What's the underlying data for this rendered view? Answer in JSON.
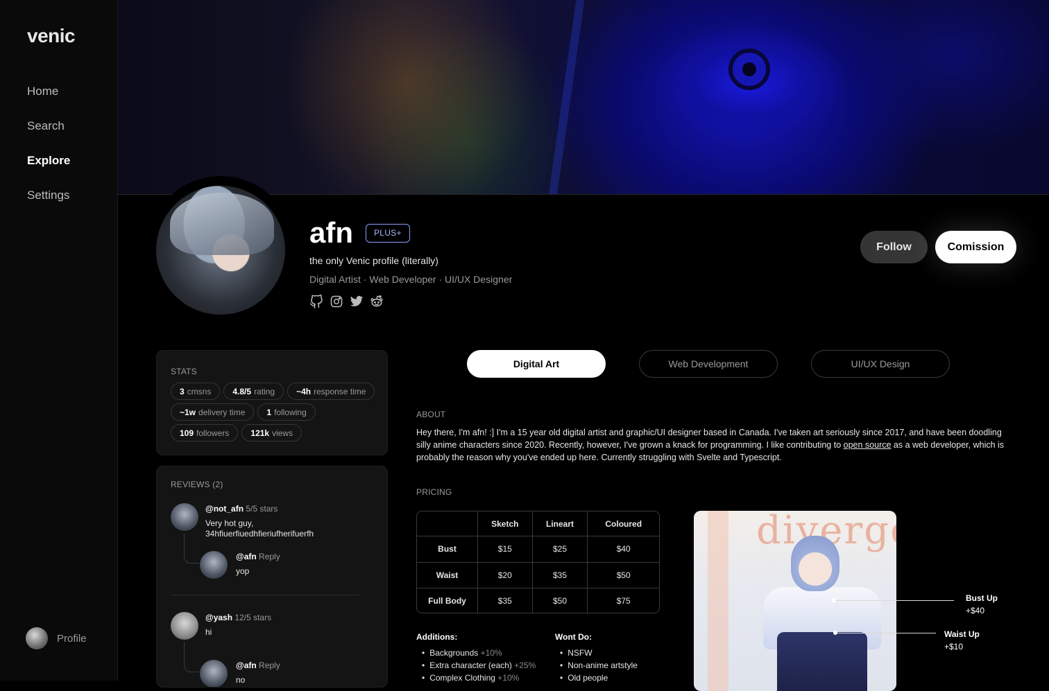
{
  "sidebar": {
    "logo": "venic",
    "nav": [
      {
        "label": "Home",
        "active": false
      },
      {
        "label": "Search",
        "active": false
      },
      {
        "label": "Explore",
        "active": true
      },
      {
        "label": "Settings",
        "active": false
      }
    ],
    "profile_label": "Profile"
  },
  "profile": {
    "username": "afn",
    "badge": "PLUS+",
    "tagline": "the only Venic profile (literally)",
    "roles": "Digital Artist · Web Developer · UI/UX Designer",
    "socials": [
      "github-icon",
      "instagram-icon",
      "twitter-icon",
      "reddit-icon"
    ],
    "follow_label": "Follow",
    "commission_label": "Comission"
  },
  "stats": {
    "title": "STATS",
    "chips": [
      {
        "value": "3",
        "label": "cmsns"
      },
      {
        "value": "4.8/5",
        "label": "rating"
      },
      {
        "value": "~4h",
        "label": "response time"
      },
      {
        "value": "~1w",
        "label": "delivery time"
      },
      {
        "value": "1",
        "label": "following"
      },
      {
        "value": "109",
        "label": "followers"
      },
      {
        "value": "121k",
        "label": "views"
      }
    ]
  },
  "reviews": {
    "title": "REVIEWS (2)",
    "items": [
      {
        "user": "@not_afn",
        "meta": "5/5 stars",
        "text": "Very hot guy, 34hfiuerfiuedhfieriufherifuerfh",
        "reply": {
          "user": "@afn",
          "meta": "Reply",
          "text": "yop"
        }
      },
      {
        "user": "@yash",
        "meta": "12/5 stars",
        "text": "hi",
        "reply": {
          "user": "@afn",
          "meta": "Reply",
          "text": "no"
        }
      }
    ]
  },
  "tabs": [
    {
      "label": "Digital Art",
      "active": true
    },
    {
      "label": "Web Development",
      "active": false
    },
    {
      "label": "UI/UX Design",
      "active": false
    }
  ],
  "about": {
    "title": "ABOUT",
    "text_before": "Hey there, I'm afn! :] I'm a 15 year old digital artist and graphic/UI designer based in Canada. I've taken art seriously since 2017, and have been doodling silly anime characters since 2020. Recently, however, I've grown a knack for programming. I like contributing to ",
    "link": "open source",
    "text_after": " as a web developer, which is probably the reason why you've ended up here. Currently struggling with Svelte and Typescript."
  },
  "pricing": {
    "title": "PRICING",
    "columns": [
      "Sketch",
      "Lineart",
      "Coloured"
    ],
    "rows": [
      {
        "label": "Bust",
        "values": [
          "$15",
          "$25",
          "$40"
        ]
      },
      {
        "label": "Waist",
        "values": [
          "$20",
          "$35",
          "$50"
        ]
      },
      {
        "label": "Full Body",
        "values": [
          "$35",
          "$50",
          "$75"
        ]
      }
    ],
    "additions_title": "Additions:",
    "additions": [
      {
        "label": "Backgrounds",
        "price": "+10%"
      },
      {
        "label": "Extra character (each)",
        "price": "+25%"
      },
      {
        "label": "Complex Clothing",
        "price": "+10%"
      }
    ],
    "wont_title": "Wont Do:",
    "wont": [
      "NSFW",
      "Non-anime artstyle",
      "Old people"
    ]
  },
  "art_preview": {
    "watermark": "diverge",
    "annotations": [
      {
        "label": "Bust Up",
        "price": "+$40"
      },
      {
        "label": "Waist Up",
        "price": "+$10"
      }
    ]
  }
}
